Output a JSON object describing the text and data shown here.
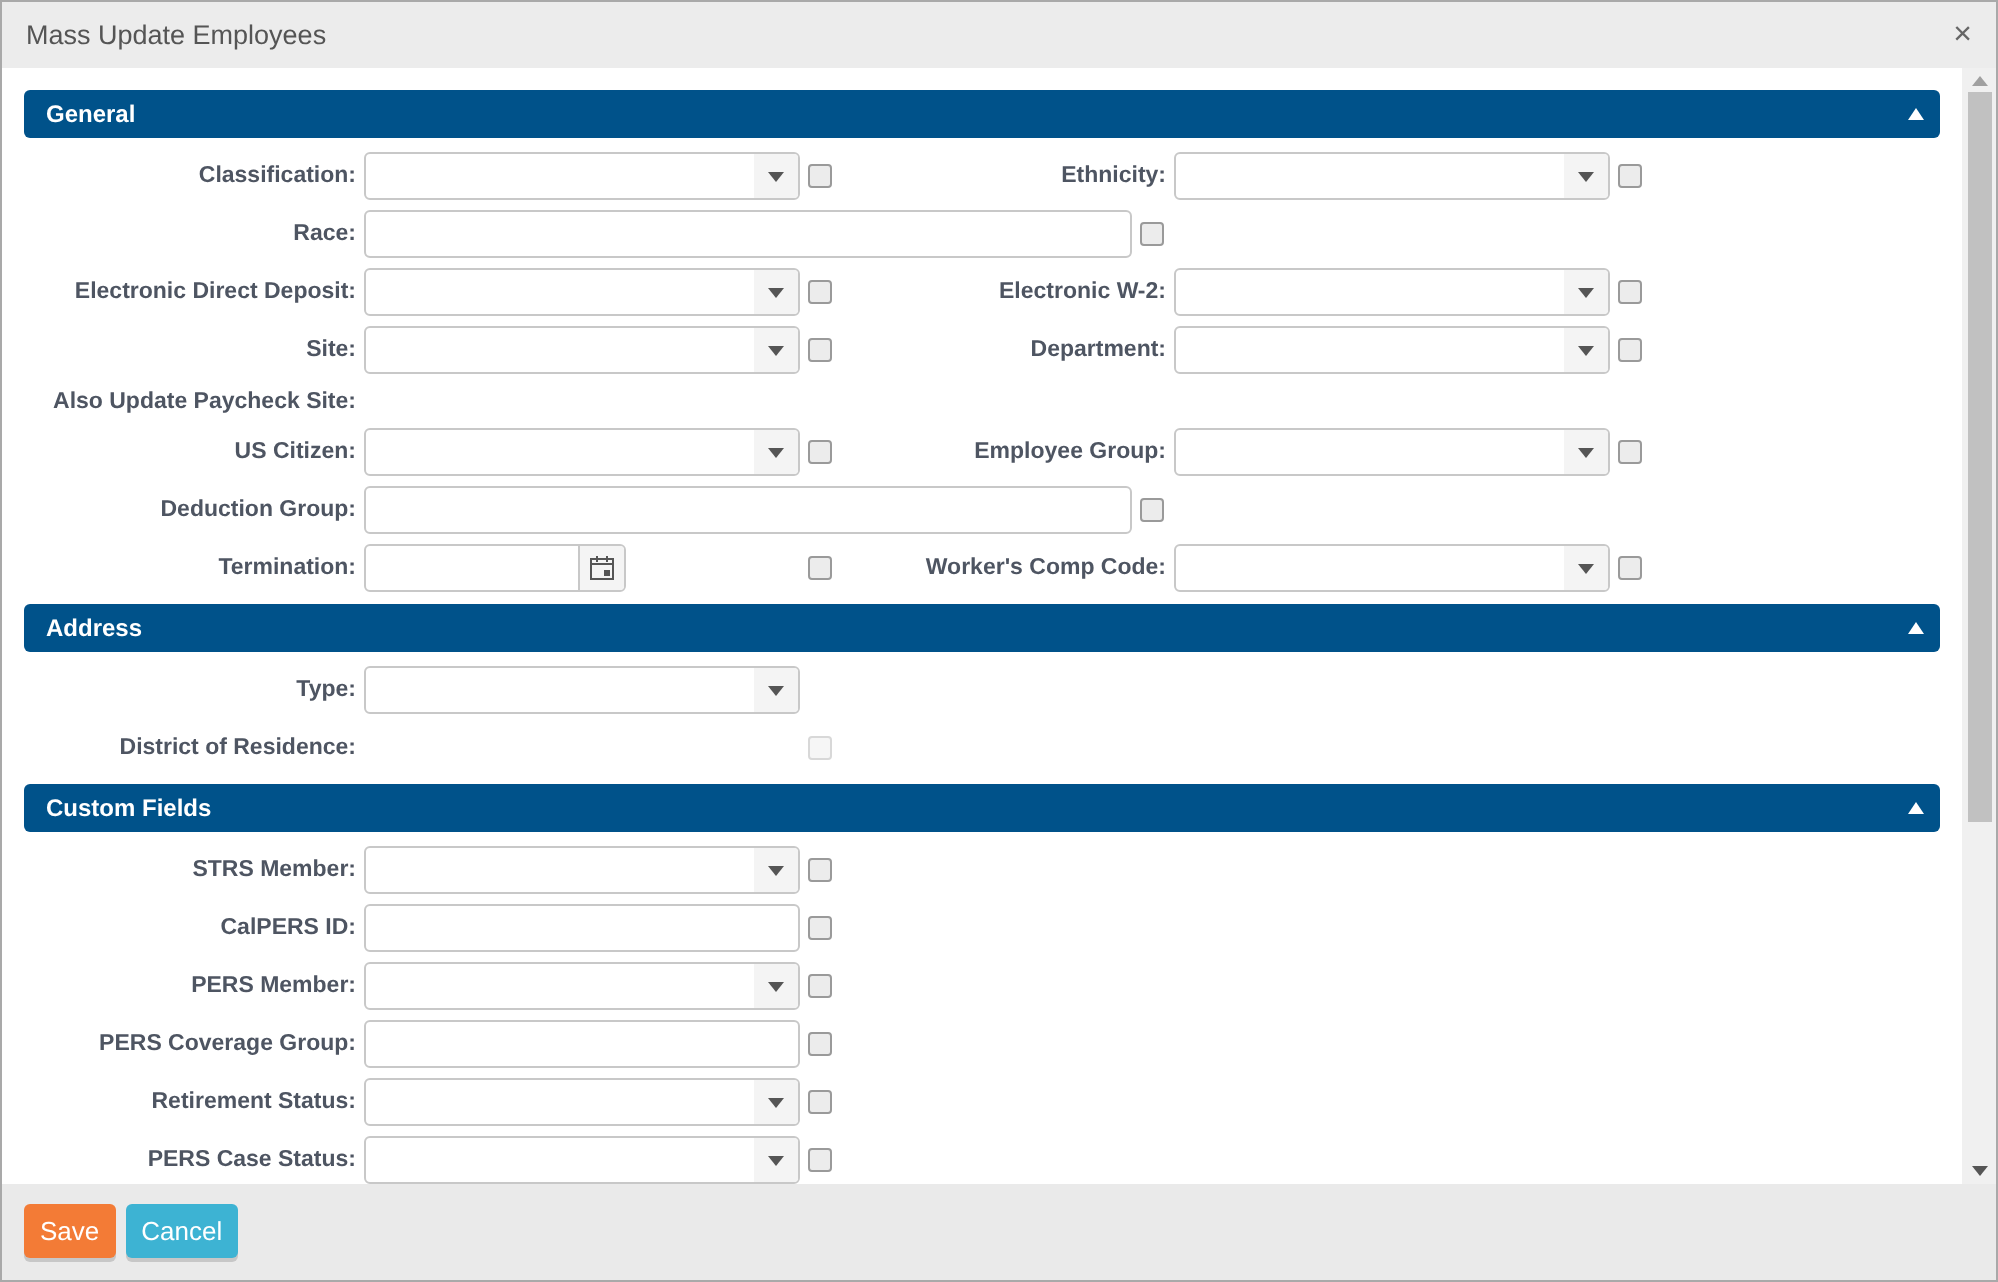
{
  "window": {
    "title": "Mass Update Employees",
    "close": "×"
  },
  "sections": [
    {
      "title": "General",
      "expanded": true,
      "rows": [
        [
          {
            "label": "Classification:",
            "kind": "select",
            "checked": false,
            "disabled": false
          },
          {
            "label": "Ethnicity:",
            "kind": "select",
            "checked": false,
            "disabled": false
          }
        ],
        [
          {
            "label": "Race:",
            "kind": "wide-text",
            "checked": false,
            "disabled": false
          }
        ],
        [
          {
            "label": "Electronic Direct Deposit:",
            "kind": "select",
            "checked": false,
            "disabled": false
          },
          {
            "label": "Electronic W-2:",
            "kind": "select",
            "checked": false,
            "disabled": false
          }
        ],
        [
          {
            "label": "Site:",
            "kind": "select",
            "checked": false,
            "disabled": false
          },
          {
            "label": "Department:",
            "kind": "select",
            "checked": false,
            "disabled": false
          }
        ],
        [
          {
            "label": "Also Update Paycheck Site:",
            "kind": "heading"
          }
        ],
        [
          {
            "label": "US Citizen:",
            "kind": "select",
            "checked": false,
            "disabled": false
          },
          {
            "label": "Employee Group:",
            "kind": "select",
            "checked": false,
            "disabled": false
          }
        ],
        [
          {
            "label": "Deduction Group:",
            "kind": "wide-text",
            "checked": false,
            "disabled": false
          }
        ],
        [
          {
            "label": "Termination:",
            "kind": "date",
            "checked": false,
            "disabled": false
          },
          {
            "label": "Worker's Comp Code:",
            "kind": "select",
            "checked": false,
            "disabled": false
          }
        ]
      ]
    },
    {
      "title": "Address",
      "expanded": true,
      "rows": [
        [
          {
            "label": "Type:",
            "kind": "select-only"
          }
        ],
        [
          {
            "label": "District of Residence:",
            "kind": "checkbox-only",
            "checked": false,
            "disabled": true
          }
        ]
      ]
    },
    {
      "title": "Custom Fields",
      "expanded": true,
      "rows": [
        [
          {
            "label": "STRS Member:",
            "kind": "select",
            "checked": false,
            "disabled": false
          }
        ],
        [
          {
            "label": "CalPERS ID:",
            "kind": "text",
            "checked": false,
            "disabled": false
          }
        ],
        [
          {
            "label": "PERS Member:",
            "kind": "select",
            "checked": false,
            "disabled": false
          }
        ],
        [
          {
            "label": "PERS Coverage Group:",
            "kind": "text",
            "checked": false,
            "disabled": false
          }
        ],
        [
          {
            "label": "Retirement Status:",
            "kind": "select",
            "checked": false,
            "disabled": false
          }
        ],
        [
          {
            "label": "PERS Case Status:",
            "kind": "select",
            "checked": false,
            "disabled": false
          }
        ]
      ]
    }
  ],
  "buttons": [
    {
      "label": "Save",
      "kind": "primary"
    },
    {
      "label": "Cancel",
      "kind": "secondary"
    }
  ]
}
